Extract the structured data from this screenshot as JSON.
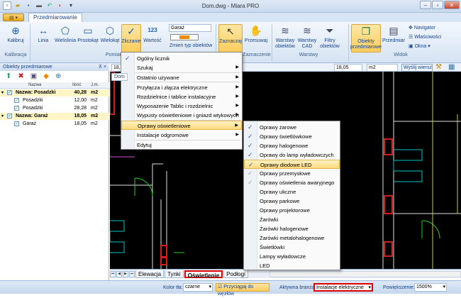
{
  "app": {
    "title": "Dom.dwg - Miara PRO",
    "tab": "Przedmiarowanie",
    "app_button": "▤ ▾"
  },
  "ribbon": {
    "buttons": [
      {
        "label": "Kalibruj",
        "icon": "crosshair-icon",
        "glyph": "⊕"
      },
      {
        "label": "Linia",
        "icon": "line-icon",
        "glyph": "↔"
      },
      {
        "label": "Wielolinia",
        "icon": "polyline-icon",
        "glyph": "⬠"
      },
      {
        "label": "Prostokąt",
        "icon": "rectangle-icon",
        "glyph": "▭"
      },
      {
        "label": "Wielokąt",
        "icon": "polygon-icon",
        "glyph": "⬡"
      },
      {
        "label": "Zliczanie",
        "icon": "check-count-icon",
        "glyph": "✓"
      },
      {
        "label": "Wartość",
        "icon": "value-icon",
        "glyph": "123"
      },
      {
        "label": "Zaznaczaj",
        "icon": "cursor-icon",
        "glyph": "↖"
      },
      {
        "label": "Przesuwaj",
        "icon": "hand-icon",
        "glyph": "✋"
      },
      {
        "label": "Warstwy obiektów",
        "icon": "layers-icon",
        "glyph": "≋"
      },
      {
        "label": "Warstwy CAD",
        "icon": "cad-layers-icon",
        "glyph": "≋"
      },
      {
        "label": "Filtry obiektów",
        "icon": "filter-icon",
        "glyph": "⏷"
      },
      {
        "label": "Obiekty przedmiarowe",
        "icon": "objects-icon",
        "glyph": "❐"
      },
      {
        "label": "Przedmiar",
        "icon": "estimate-icon",
        "glyph": "▤"
      }
    ],
    "small": [
      {
        "label": "Navigator",
        "glyph": "✥"
      },
      {
        "label": "Właściwości",
        "glyph": "☰"
      },
      {
        "label": "Okna",
        "glyph": "▣"
      }
    ],
    "type_field": "Garaż",
    "type_button": "Zmień typ obiektów",
    "groups": [
      "Kalibracja",
      "Pomiar",
      "Zaznaczenie",
      "Warstwy",
      "Widok"
    ]
  },
  "inputbar": {
    "v1": "18,0",
    "v2": "18,05",
    "unit": "m2",
    "clear": "Wyślij wiersz"
  },
  "doc_tab": "Dom",
  "left_panel": {
    "title": "Obiekty przedmiarowe",
    "pin": "⊼ ×",
    "tools": [
      "⬆",
      "✖",
      "▣",
      "◆",
      "⊕"
    ],
    "cols": [
      "Nazwa",
      "Ilość",
      "J.m."
    ],
    "rows": [
      {
        "name": "Nazwa: Posadzki",
        "qty": "40,28",
        "unit": "m2",
        "group": true
      },
      {
        "name": "Posadzki",
        "qty": "12,00",
        "unit": "m2",
        "group": false
      },
      {
        "name": "Posadzki",
        "qty": "28,28",
        "unit": "m2",
        "group": false
      },
      {
        "name": "Nazwa: Garaż",
        "qty": "18,05",
        "unit": "m2",
        "group": true
      },
      {
        "name": "Garaż",
        "qty": "18,05",
        "unit": "m2",
        "group": false
      }
    ]
  },
  "menu": {
    "items": [
      "Ogólny licznik",
      "Szukaj",
      "Ostatnio używane",
      "Przyłącza i złącza elektryczne",
      "Rozdzielnice i tablice instalacyjne",
      "Wyposażenie Tablic i rozdzielnic",
      "Wypusty oświetleniowe i gniazd wtykowych",
      "Oprawy oświetleniowe",
      "Instalacje odgromowe",
      "Edytuj"
    ],
    "submenu": [
      "Oprawy żarowe",
      "Oprawy świetlówkowe",
      "Oprawy halogenowe",
      "Oprawy do lamp wyładowczych",
      "Oprawy diodowe LED",
      "Oprawy przemysłowe",
      "Oprawy oświetlenia awaryjnego",
      "Oprawy uliczne",
      "Oprawy parkowe",
      "Oprawy projektorowe",
      "Żarówki",
      "Żarówki halogenowe",
      "Żarówki metalohalogenowe",
      "Świetlówki",
      "Lampy wyładowcze",
      "LED"
    ]
  },
  "bottom_tabs": [
    "Elewacja",
    "Tynki",
    "Oświetlenie",
    "Podłogi"
  ],
  "status": {
    "bg_label": "Kolor tła:",
    "bg_value": "czarne",
    "snap": "Przyciągaj do węzłów",
    "branch_label": "Aktywna branża:",
    "branch_value": "Instalacje elektryczne",
    "zoom_label": "Powiększenie:",
    "zoom_value": "1500%"
  }
}
